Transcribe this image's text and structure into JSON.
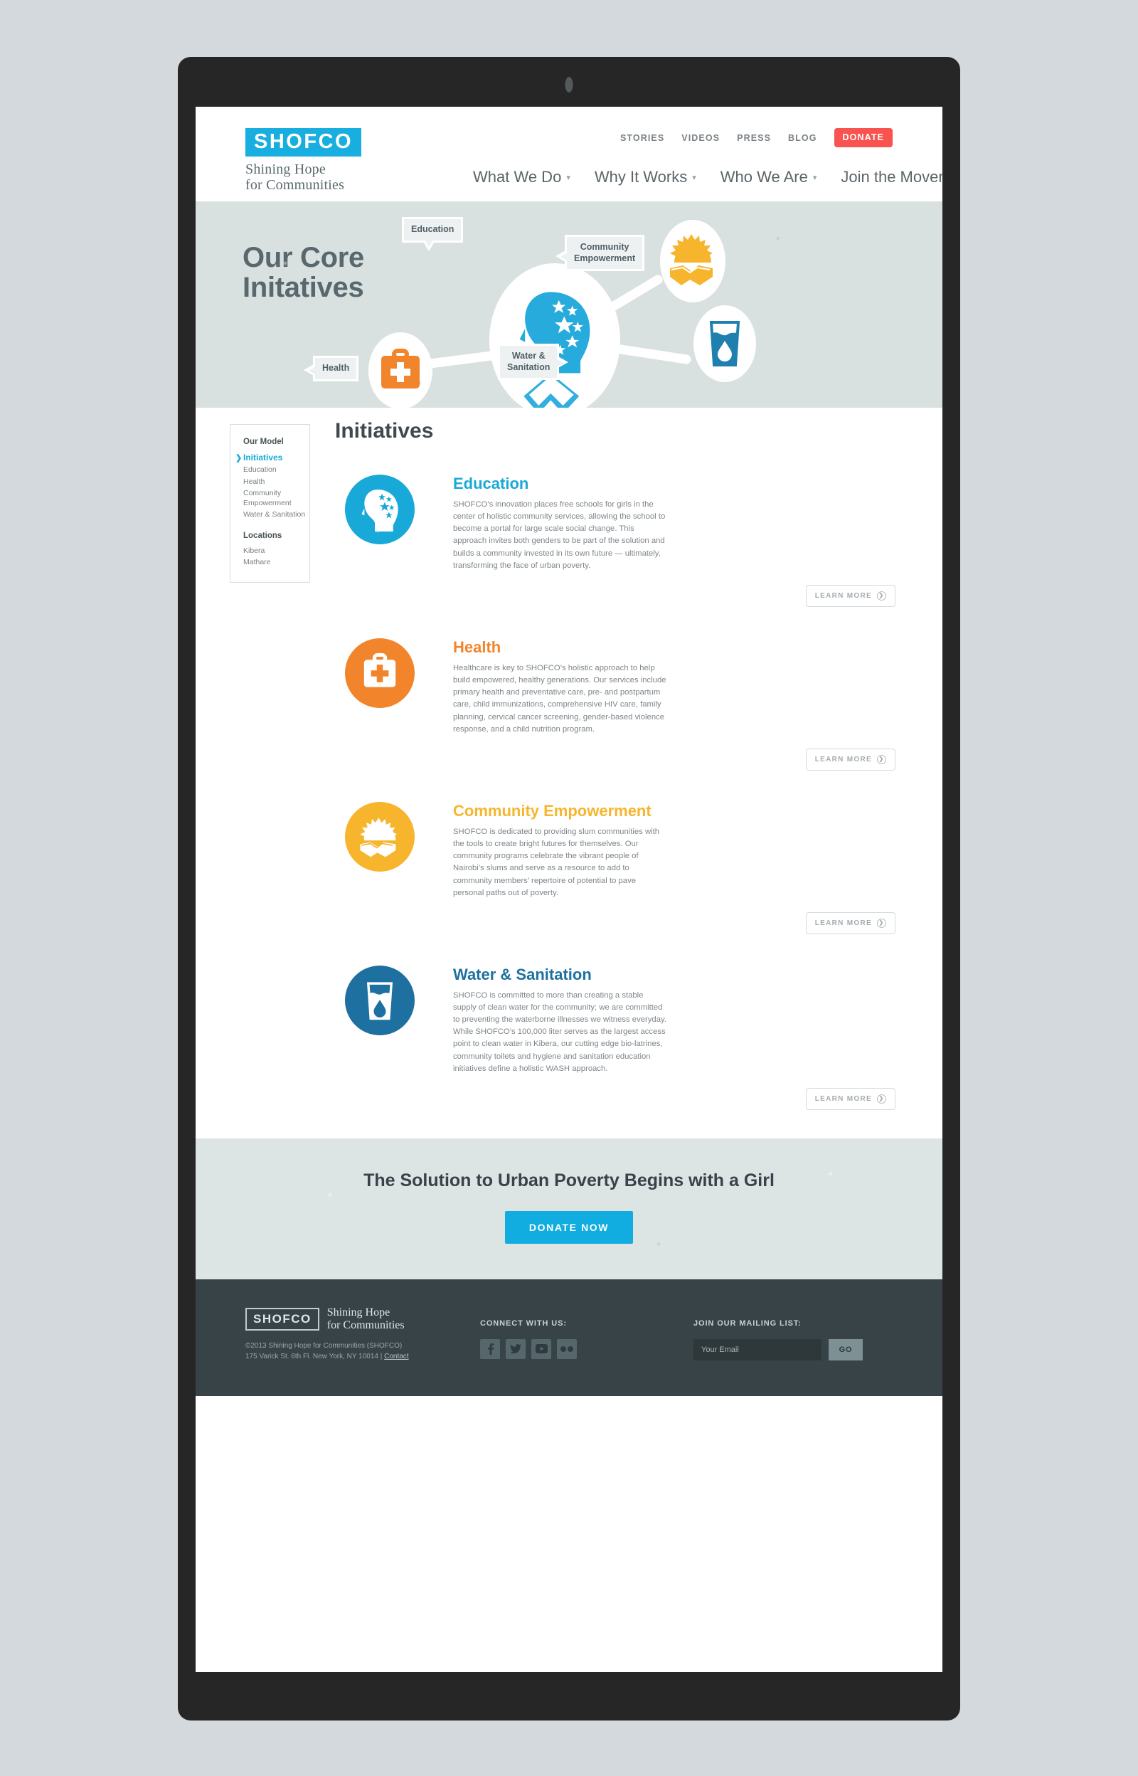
{
  "header": {
    "logo_mark": "SHOFCO",
    "logo_tagline_line1": "Shining Hope",
    "logo_tagline_line2": "for Communities",
    "utility_nav": [
      {
        "label": "STORIES"
      },
      {
        "label": "VIDEOS"
      },
      {
        "label": "PRESS"
      },
      {
        "label": "BLOG"
      }
    ],
    "donate_label": "DONATE",
    "main_nav": [
      {
        "label": "What We Do"
      },
      {
        "label": "Why It Works"
      },
      {
        "label": "Who We Are"
      },
      {
        "label": "Join the Movement"
      }
    ]
  },
  "hero": {
    "title_line1": "Our Core",
    "title_line2": "Initatives",
    "callouts": {
      "education": "Education",
      "community_line1": "Community",
      "community_line2": "Empowerment",
      "health": "Health",
      "water_line1": "Water &",
      "water_line2": "Sanitation"
    }
  },
  "sidebar": {
    "group1_title": "Our Model",
    "group1_items": [
      {
        "label": "Initiatives",
        "active": true
      },
      {
        "label": "Education",
        "active": false
      },
      {
        "label": "Health",
        "active": false
      },
      {
        "label": "Community Empowerment",
        "active": false
      },
      {
        "label": "Water & Sanitation",
        "active": false
      }
    ],
    "group2_title": "Locations",
    "group2_items": [
      {
        "label": "Kibera"
      },
      {
        "label": "Mathare"
      }
    ]
  },
  "main": {
    "page_title": "Initiatives",
    "learn_more_label": "LEARN MORE",
    "initiatives": [
      {
        "title": "Education",
        "color": "#18a9d8",
        "icon": "head-stars-icon",
        "description": "SHOFCO’s innovation places free schools for girls in the center of holistic community services, allowing the school to become a portal for large scale social change. This approach invites both genders to be part of the solution and builds a community invested in its own future — ultimately, transforming the face of urban poverty."
      },
      {
        "title": "Health",
        "color": "#f2852b",
        "icon": "medical-bag-icon",
        "description": "Healthcare is key to SHOFCO’s holistic approach to help build empowered, healthy generations. Our services include primary health and preventative care, pre- and postpartum care, child immunizations, comprehensive HIV care, family planning, cervical cancer screening, gender-based violence response, and a child nutrition program."
      },
      {
        "title": "Community Empowerment",
        "color": "#f7b52e",
        "icon": "handshake-sun-icon",
        "description": "SHOFCO is dedicated to providing slum communities with the tools to create bright futures for themselves. Our community programs celebrate the vibrant people of Nairobi’s slums and serve as a resource to add to community members’ repertoire of potential to pave personal paths out of poverty."
      },
      {
        "title": "Water & Sanitation",
        "color": "#1d709f",
        "icon": "water-glass-icon",
        "description": "SHOFCO is committed to more than creating a stable supply of clean water for the community; we are committed to preventing the waterborne illnesses we witness everyday. While SHOFCO’s 100,000 liter serves as the largest access point to clean water in Kibera, our cutting edge bio-latrines, community toilets and hygiene and sanitation education initiatives define a holistic WASH approach."
      }
    ]
  },
  "cta": {
    "title": "The Solution to Urban Poverty Begins with a Girl",
    "button_label": "DONATE NOW"
  },
  "footer": {
    "logo_mark": "SHOFCO",
    "logo_tagline_line1": "Shining Hope",
    "logo_tagline_line2": "for Communities",
    "copyright": "©2013 Shining Hope for Communities (SHOFCO)",
    "address": "175 Varick St. 6th Fl. New York, NY 10014",
    "address_separator": "|",
    "contact_label": "Contact",
    "connect_title": "CONNECT WITH US:",
    "social": [
      {
        "name": "facebook-icon",
        "glyph": "f"
      },
      {
        "name": "twitter-icon",
        "glyph": "t"
      },
      {
        "name": "youtube-icon",
        "glyph": "y"
      },
      {
        "name": "flickr-icon",
        "glyph": "fl"
      }
    ],
    "mailing_title": "JOIN OUR MAILING LIST:",
    "email_placeholder": "Your Email",
    "email_value": "",
    "go_label": "GO"
  },
  "colors": {
    "brand_blue": "#18afe0",
    "donate_red": "#f9534f",
    "education": "#18a9d8",
    "health": "#f2852b",
    "community": "#f7b52e",
    "water": "#1d709f",
    "footer_bg": "#374347",
    "hero_bg": "#d9e1e0"
  }
}
